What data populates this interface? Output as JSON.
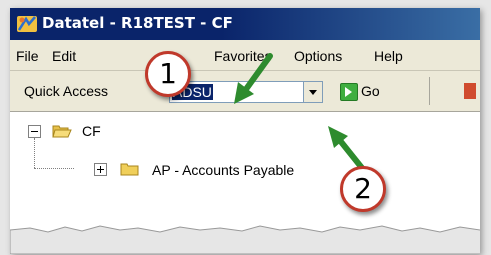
{
  "window": {
    "title": "Datatel - R18TEST - CF"
  },
  "menu": {
    "items": [
      "File",
      "Edit",
      "Favorites",
      "Options",
      "Help"
    ]
  },
  "toolbar": {
    "quick_access_label": "Quick Access",
    "quick_access_value": "ADSU",
    "go_label": "Go"
  },
  "tree": {
    "root_label": "CF",
    "child_label": "AP - Accounts Payable"
  },
  "callouts": [
    "1",
    "2"
  ],
  "colors": {
    "title_bar": "#0a246a",
    "callout_ring": "#c0392b",
    "arrow": "#2e8b2e",
    "selection": "#0a246a"
  }
}
